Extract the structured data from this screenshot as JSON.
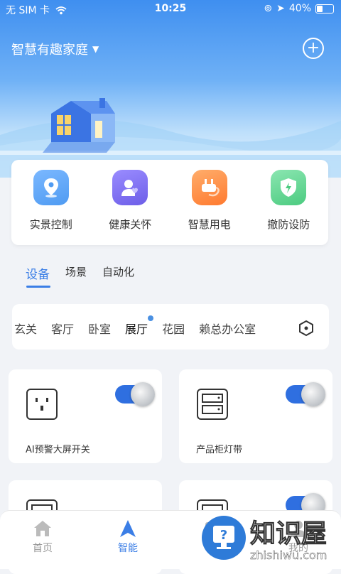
{
  "status": {
    "carrier": "无 SIM 卡",
    "time": "10:25",
    "battery": "40%",
    "battery_level": 0.4
  },
  "header": {
    "home_name": "智慧有趣家庭",
    "add_label": "+"
  },
  "quick_actions": [
    {
      "label": "实景控制",
      "icon": "location-pin-icon",
      "color": "#4f9bf2"
    },
    {
      "label": "健康关怀",
      "icon": "person-heart-icon",
      "color": "#7466f0"
    },
    {
      "label": "智慧用电",
      "icon": "plug-icon",
      "color": "#ff8a3c"
    },
    {
      "label": "撤防设防",
      "icon": "shield-bolt-icon",
      "color": "#5fd08e"
    }
  ],
  "tabs": [
    {
      "label": "设备",
      "active": true
    },
    {
      "label": "场景",
      "active": false
    },
    {
      "label": "自动化",
      "active": false
    }
  ],
  "rooms": [
    "玄关",
    "客厅",
    "卧室",
    "展厅",
    "花园",
    "赖总办公室"
  ],
  "active_room": "展厅",
  "devices": [
    {
      "name": "AI预警大屏开关",
      "icon": "socket-icon",
      "on": true
    },
    {
      "name": "产品柜灯带",
      "icon": "cabinet-icon",
      "on": true
    },
    {
      "name": "",
      "icon": "cabinet-icon",
      "on": false
    },
    {
      "name": "",
      "icon": "cabinet-icon",
      "on": true
    }
  ],
  "bottom_nav": [
    {
      "label": "首页",
      "icon": "home-icon",
      "active": false
    },
    {
      "label": "智能",
      "icon": "navigation-arrow-icon",
      "active": true
    },
    {
      "label": "",
      "icon": "device-icon",
      "active": false
    },
    {
      "label": "我的",
      "icon": "person-icon",
      "active": false
    }
  ],
  "watermark": {
    "title": "知识屋",
    "url": "zhishiwu.com"
  },
  "colors": {
    "accent": "#3b7ee6",
    "toggle_on": "#2f6fe0"
  }
}
